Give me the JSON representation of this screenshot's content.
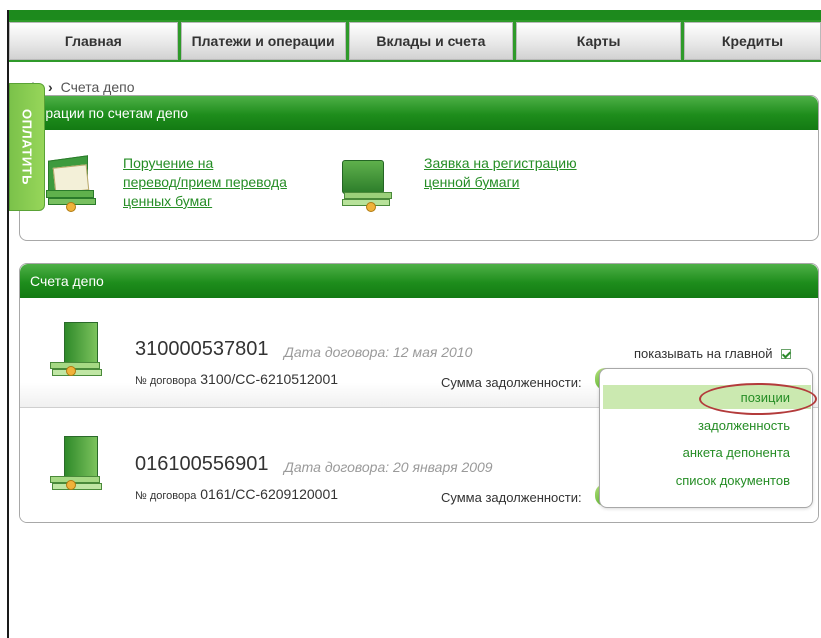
{
  "nav": {
    "tabs": [
      "Главная",
      "Платежи и операции",
      "Вклады и счета",
      "Карты",
      "Кредиты"
    ]
  },
  "breadcrumb": {
    "current": "Счета депо"
  },
  "pay_tab": {
    "label": "ОПЛАТИТЬ"
  },
  "operations": {
    "title": "перации по счетам депо",
    "items": [
      {
        "label": "Поручение на\nперевод/прием перевода\nценных бумаг",
        "icon": "documents-folder-icon"
      },
      {
        "label": "Заявка на регистрацию\nценной бумаги",
        "icon": "briefcase-icon"
      }
    ]
  },
  "accounts": {
    "title": "Счета депо",
    "show_on_main": "показывать на главной",
    "items": [
      {
        "number": "310000537801",
        "date": "Дата договора: 12 мая 2010",
        "contract_prefix": "№ договора",
        "contract": "3100/СС-6210512001",
        "debt_label": "Сумма задолженности:"
      },
      {
        "number": "016100556901",
        "date": "Дата договора: 20 января 2009",
        "contract_prefix": "№ договора",
        "contract": "0161/СС-6209120001",
        "debt_label": "Сумма задолженности:"
      }
    ]
  },
  "dropdown": {
    "items": [
      "позиции",
      "задолженность",
      "анкета депонента",
      "список документов"
    ],
    "highlighted": "позиции"
  },
  "colors": {
    "brand_green": "#1e8d1c",
    "link_green": "#258d25",
    "highlight": "#cbe9b0",
    "annotation_red": "#b33b3b"
  }
}
